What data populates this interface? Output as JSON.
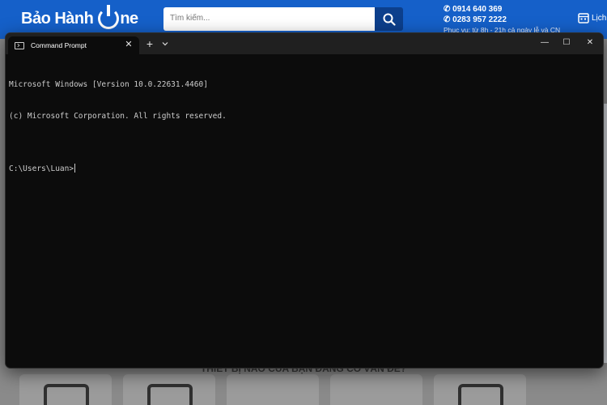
{
  "website": {
    "logo_text": "Bảo Hành",
    "logo_suffix": "ne",
    "search": {
      "placeholder": "Tìm kiếm..."
    },
    "contact": {
      "phone1": "0914 640 369",
      "phone2": "0283 957 2222",
      "hours": "Phục vụ: từ 8h - 21h cả ngày lễ và CN"
    },
    "schedule_link": "Lịch",
    "question_text": "THIẾT BỊ NÀO CỦA BẠN ĐANG CÓ VẤN ĐỀ?",
    "brand_color": "#1560c9"
  },
  "terminal": {
    "tab_title": "Command Prompt",
    "tab_close": "✕",
    "new_tab": "+",
    "minimize": "—",
    "maximize": "☐",
    "close": "✕",
    "lines": [
      "Microsoft Windows [Version 10.0.22631.4460]",
      "(c) Microsoft Corporation. All rights reserved.",
      "",
      "C:\\Users\\Luan>"
    ]
  }
}
